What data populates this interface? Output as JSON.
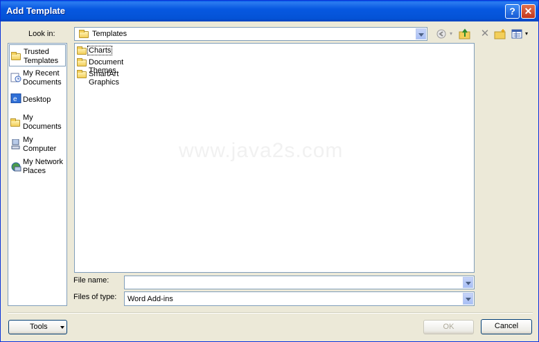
{
  "window": {
    "title": "Add Template",
    "help_glyph": "?",
    "close_glyph": "✕"
  },
  "lookin": {
    "label": "Look in:",
    "value": "Templates"
  },
  "toolbar": {
    "icons": [
      "back-icon",
      "up-folder-icon",
      "delete-icon",
      "new-folder-icon",
      "views-icon"
    ]
  },
  "places": [
    {
      "label": "Trusted Templates",
      "icon": "folder-icon"
    },
    {
      "label": "My Recent Documents",
      "icon": "recent-documents-icon"
    },
    {
      "label": "Desktop",
      "icon": "desktop-icon"
    },
    {
      "label": "My Documents",
      "icon": "my-documents-icon"
    },
    {
      "label": "My Computer",
      "icon": "computer-icon"
    },
    {
      "label": "My Network Places",
      "icon": "network-places-icon"
    }
  ],
  "files": [
    {
      "label": "Charts"
    },
    {
      "label": "Document Themes"
    },
    {
      "label": "SmartArt Graphics"
    }
  ],
  "watermark": "www.java2s.com",
  "filename": {
    "label": "File name:",
    "value": ""
  },
  "filetype": {
    "label": "Files of type:",
    "value": "Word Add-ins"
  },
  "buttons": {
    "tools": "Tools",
    "ok": "OK",
    "cancel": "Cancel"
  }
}
